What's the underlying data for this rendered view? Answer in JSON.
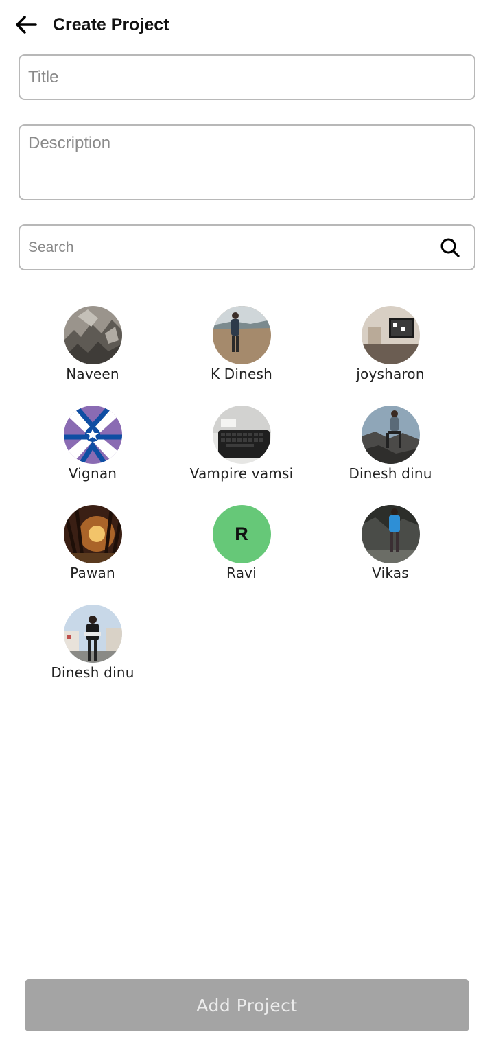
{
  "header": {
    "title": "Create Project",
    "back_icon": "arrow-left-icon"
  },
  "form": {
    "title_placeholder": "Title",
    "title_value": "",
    "description_placeholder": "Description",
    "description_value": "",
    "search_placeholder": "Search",
    "search_value": "",
    "search_icon": "search-icon"
  },
  "people": [
    {
      "name": "Naveen",
      "avatar": "photo-rocks"
    },
    {
      "name": "K Dinesh",
      "avatar": "photo-person-beach"
    },
    {
      "name": "joysharon",
      "avatar": "photo-room-tv"
    },
    {
      "name": "Vignan",
      "avatar": "logo-vignan"
    },
    {
      "name": "Vampire vamsi",
      "avatar": "photo-laptop"
    },
    {
      "name": "Dinesh dinu",
      "avatar": "photo-person-rocks"
    },
    {
      "name": "Pawan",
      "avatar": "photo-sunset-forest"
    },
    {
      "name": "Ravi",
      "avatar": "initial",
      "initial": "R",
      "color": "#66c878"
    },
    {
      "name": "Vikas",
      "avatar": "photo-person-cave"
    },
    {
      "name": "Dinesh dinu",
      "avatar": "photo-person-city"
    }
  ],
  "footer": {
    "add_button_label": "Add Project",
    "add_button_color": "#a4a4a4"
  }
}
